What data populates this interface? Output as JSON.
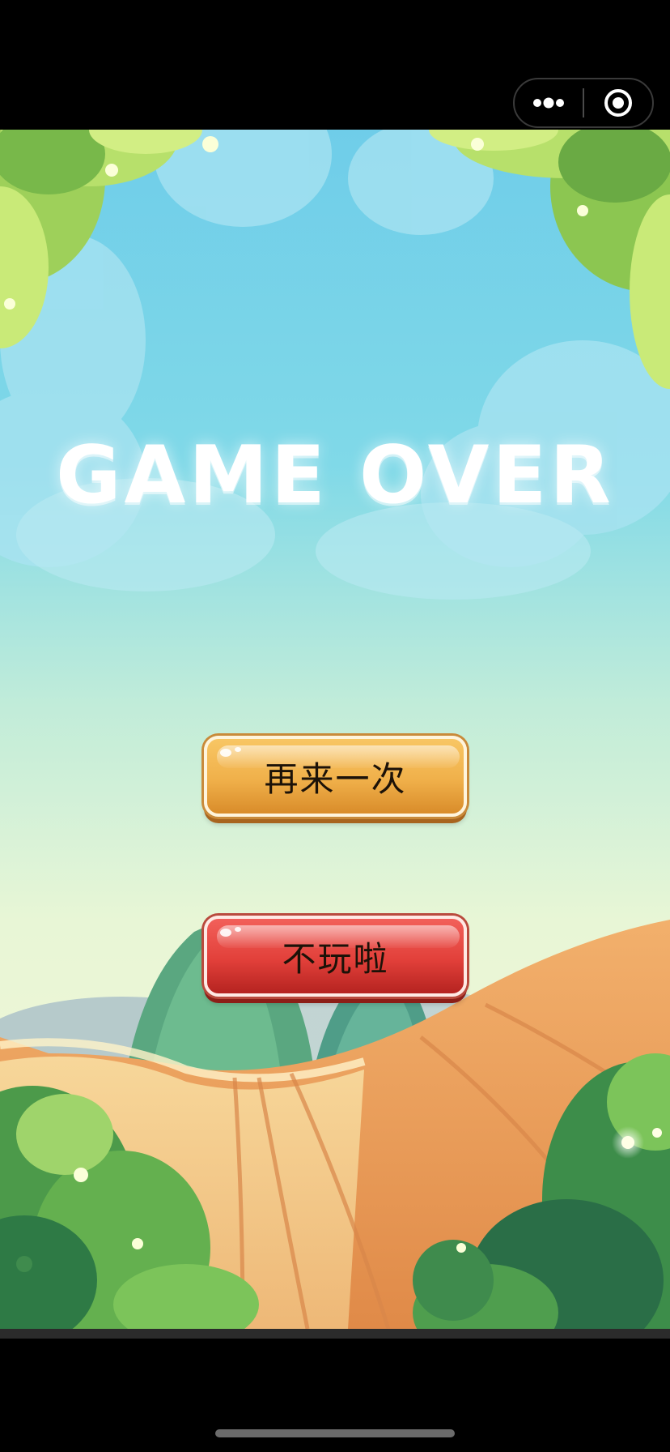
{
  "header": {
    "more_icon": "more-dots-icon",
    "close_icon": "target-record-icon"
  },
  "game": {
    "title": "GAME OVER",
    "retry_label": "再来一次",
    "quit_label": "不玩啦"
  },
  "colors": {
    "retry_button": "#f0b04a",
    "quit_button": "#e2403a",
    "sky_top": "#6fcde9",
    "sky_bottom": "#eaf5d3"
  }
}
